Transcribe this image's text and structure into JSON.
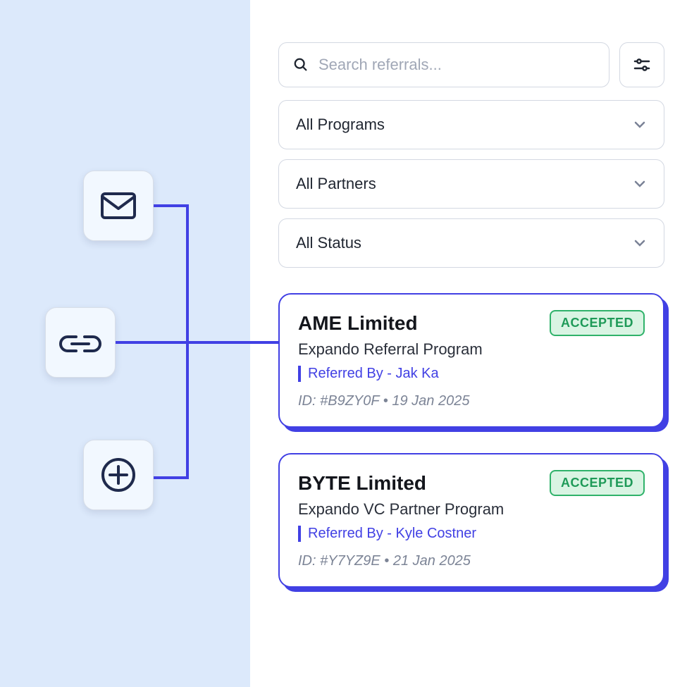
{
  "left_tiles": {
    "mail": "mail-icon",
    "link": "link-icon",
    "plus": "plus-circle-icon"
  },
  "search": {
    "placeholder": "Search referrals..."
  },
  "filters": {
    "programs": "All Programs",
    "partners": "All Partners",
    "status": "All Status"
  },
  "cards": [
    {
      "title": "AME Limited",
      "status": "ACCEPTED",
      "program": "Expando Referral Program",
      "referred_by": "Referred By - Jak Ka",
      "meta": "ID: #B9ZY0F • 19 Jan 2025"
    },
    {
      "title": "BYTE Limited",
      "status": "ACCEPTED",
      "program": "Expando VC Partner Program",
      "referred_by": "Referred By - Kyle Costner",
      "meta": "ID: #Y7YZ9E • 21 Jan 2025"
    }
  ]
}
